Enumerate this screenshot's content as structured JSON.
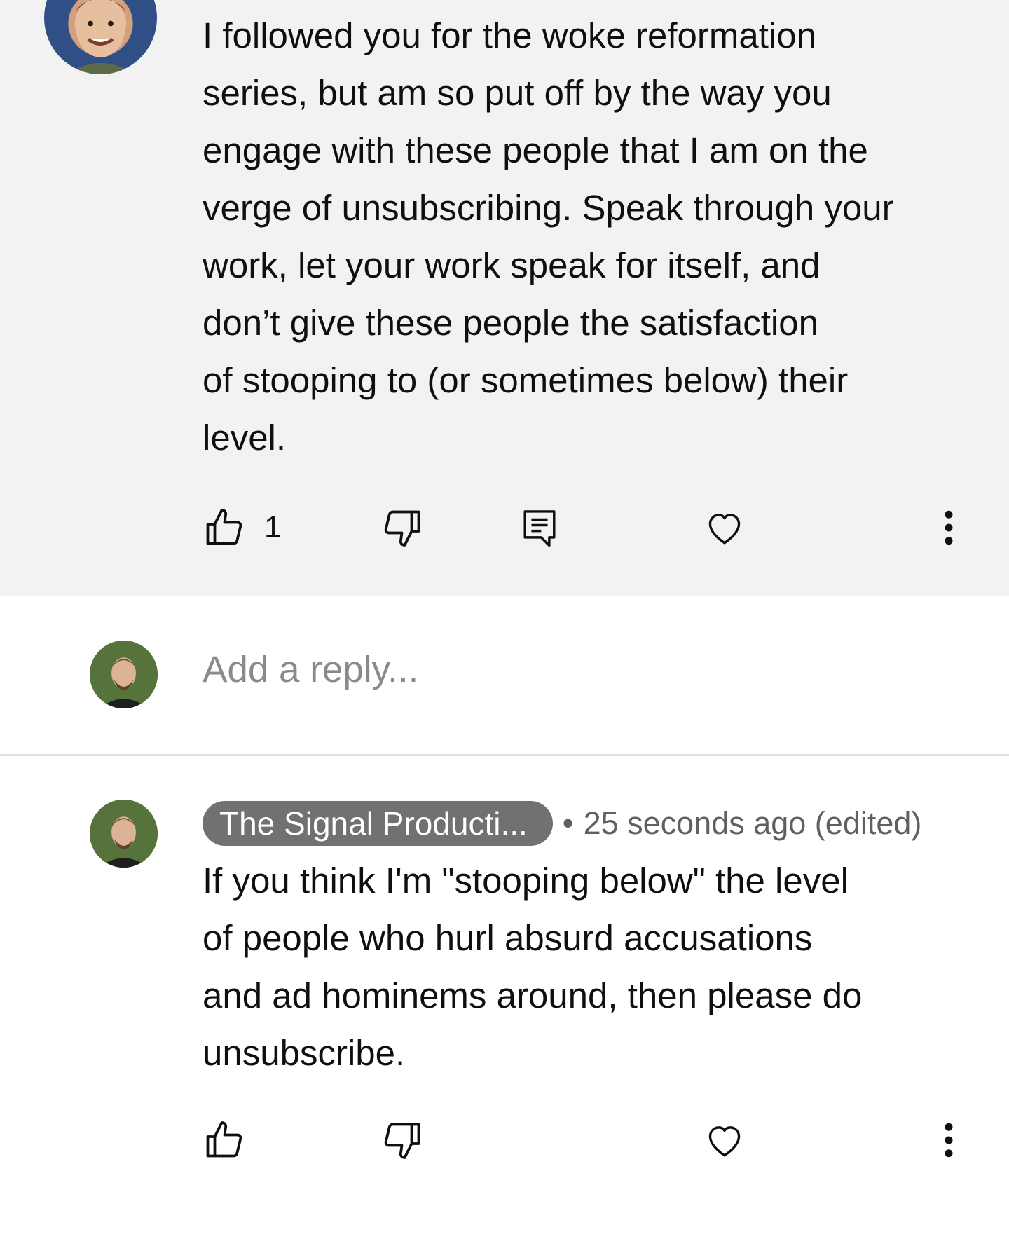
{
  "parent_comment": {
    "text": "I followed you for the woke reformation\nseries, but am so put off by the way you\nengage with these people that I am on the\nverge of unsubscribing. Speak through your\nwork, let your work speak for itself, and\ndon’t give these people the satisfaction\nof stooping to (or sometimes below) their\nlevel.",
    "like_count": "1",
    "background": "#f2f2f2",
    "actions": [
      "like-icon",
      "dislike-icon",
      "reply-icon",
      "heart-icon",
      "more-vert-icon"
    ]
  },
  "reply_composer": {
    "placeholder": "Add a reply..."
  },
  "reply_comment": {
    "author": "The Signal Producti...",
    "separator": "•",
    "timestamp": "25 seconds ago (edited)",
    "text": "If you think I'm \"stooping below\" the level\nof people who hurl absurd accusations\nand ad hominems around, then please do\nunsubscribe.",
    "author_chip_color": "#717171",
    "actions": [
      "like-icon",
      "dislike-icon",
      "heart-icon",
      "more-vert-icon"
    ]
  }
}
